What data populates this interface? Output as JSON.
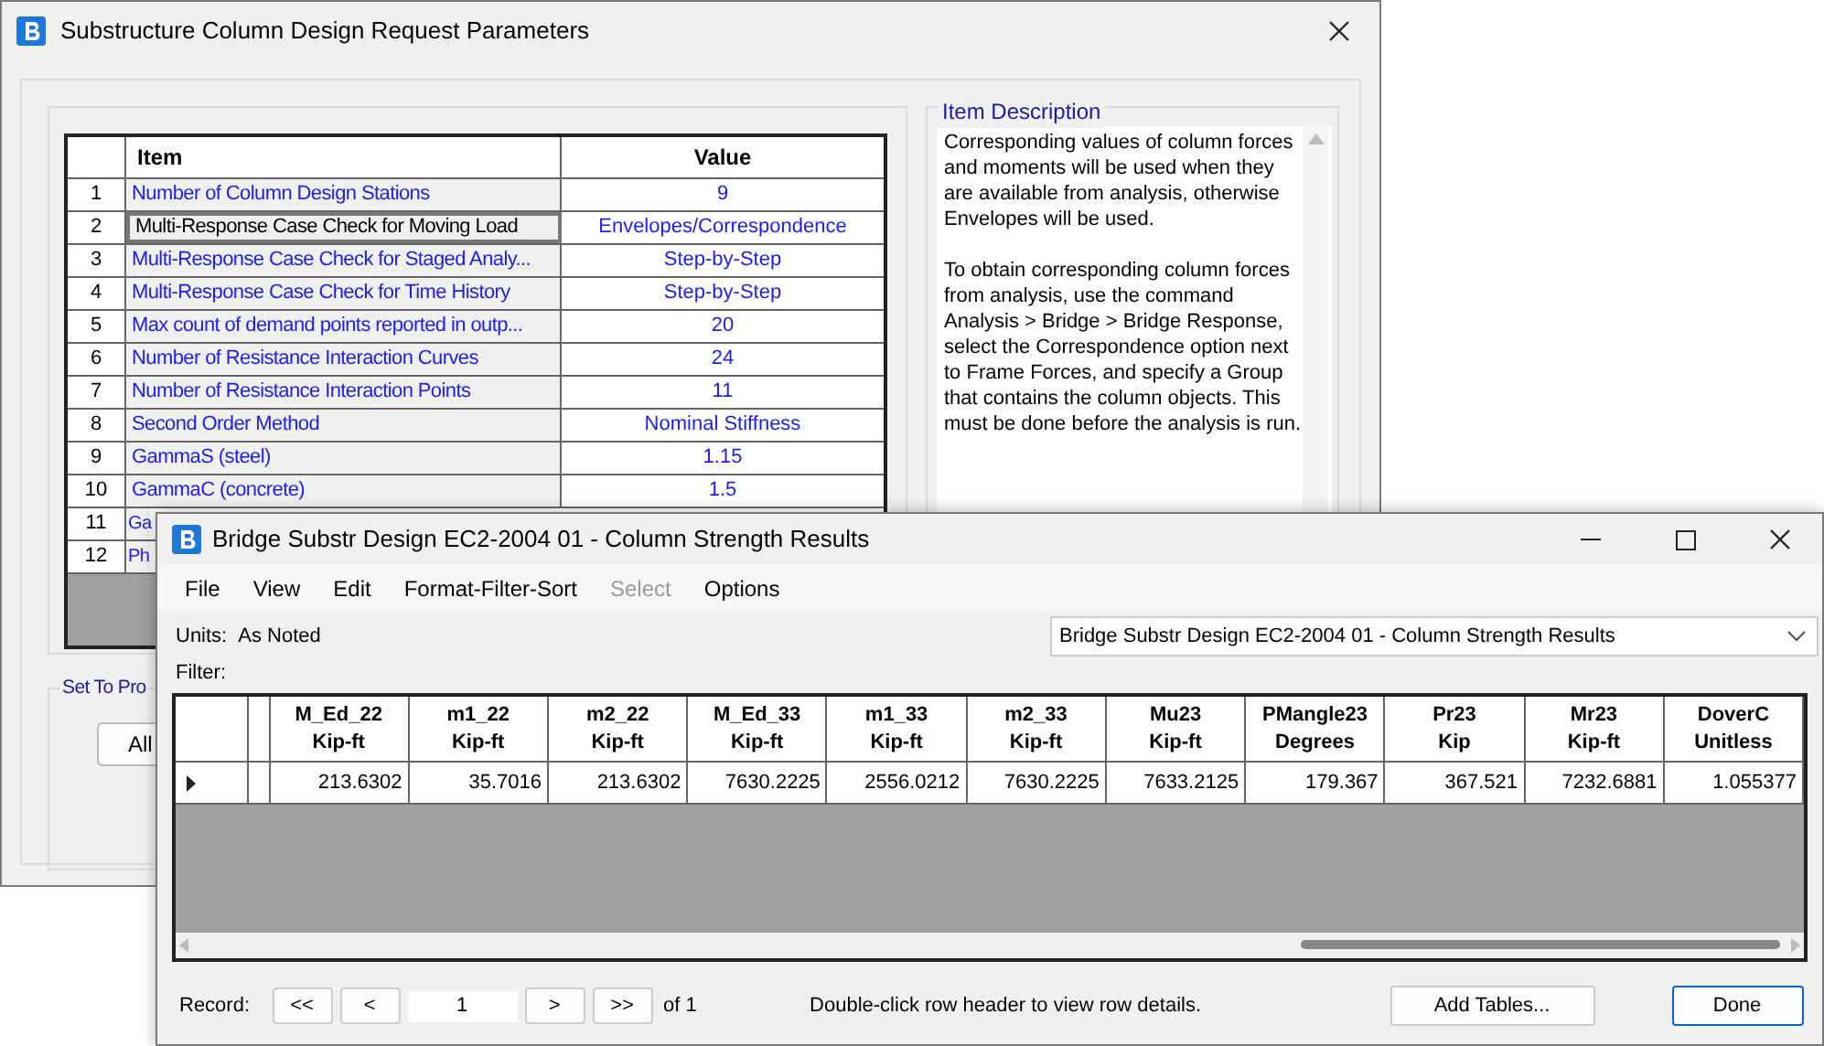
{
  "back_window": {
    "title": "Substructure Column Design Request Parameters",
    "table": {
      "columns": [
        "Item",
        "Value"
      ],
      "rows": [
        {
          "index": "1",
          "item": "Number of Column Design Stations",
          "value": "9",
          "selected": false
        },
        {
          "index": "2",
          "item": "Multi-Response Case Check for Moving Load",
          "value": "Envelopes/Correspondence",
          "selected": true
        },
        {
          "index": "3",
          "item": "Multi-Response Case Check for Staged Analy...",
          "value": "Step-by-Step",
          "selected": false
        },
        {
          "index": "4",
          "item": "Multi-Response Case Check for Time History",
          "value": "Step-by-Step",
          "selected": false
        },
        {
          "index": "5",
          "item": "Max count of demand points reported in outp...",
          "value": "20",
          "selected": false
        },
        {
          "index": "6",
          "item": "Number of Resistance Interaction Curves",
          "value": "24",
          "selected": false
        },
        {
          "index": "7",
          "item": "Number of Resistance Interaction Points",
          "value": "11",
          "selected": false
        },
        {
          "index": "8",
          "item": "Second Order Method",
          "value": "Nominal Stiffness",
          "selected": false
        },
        {
          "index": "9",
          "item": "GammaS (steel)",
          "value": "1.15",
          "selected": false
        },
        {
          "index": "10",
          "item": "GammaC (concrete)",
          "value": "1.5",
          "selected": false
        },
        {
          "index": "11",
          "item": "Ga",
          "selected": false
        },
        {
          "index": "12",
          "item": "Ph",
          "selected": false
        }
      ]
    },
    "description": {
      "label": "Item Description",
      "paragraphs": [
        "Corresponding values of column forces and moments will be used when they are available from analysis, otherwise Envelopes will be used.",
        "To obtain corresponding column forces from analysis, use the command Analysis > Bridge > Bridge Response, select the Correspondence option next to Frame Forces, and specify a Group that contains the column objects. This must be done before the analysis is run."
      ]
    },
    "group": {
      "label": "Set To Pro",
      "buttons": [
        "All"
      ]
    }
  },
  "front_window": {
    "title": "Bridge Substr Design EC2-2004 01 - Column Strength Results",
    "menu": [
      {
        "label": "File",
        "disabled": false
      },
      {
        "label": "View",
        "disabled": false
      },
      {
        "label": "Edit",
        "disabled": false
      },
      {
        "label": "Format-Filter-Sort",
        "disabled": false
      },
      {
        "label": "Select",
        "disabled": true
      },
      {
        "label": "Options",
        "disabled": false
      }
    ],
    "units_label": "Units:",
    "units_value": "As Noted",
    "filter_label": "Filter:",
    "table_select": "Bridge Substr Design EC2-2004 01 - Column Strength Results",
    "grid": {
      "columns": [
        {
          "name": "M_Ed_22",
          "unit": "Kip-ft"
        },
        {
          "name": "m1_22",
          "unit": "Kip-ft"
        },
        {
          "name": "m2_22",
          "unit": "Kip-ft"
        },
        {
          "name": "M_Ed_33",
          "unit": "Kip-ft"
        },
        {
          "name": "m1_33",
          "unit": "Kip-ft"
        },
        {
          "name": "m2_33",
          "unit": "Kip-ft"
        },
        {
          "name": "Mu23",
          "unit": "Kip-ft"
        },
        {
          "name": "PMangle23",
          "unit": "Degrees"
        },
        {
          "name": "Pr23",
          "unit": "Kip"
        },
        {
          "name": "Mr23",
          "unit": "Kip-ft"
        },
        {
          "name": "DoverC",
          "unit": "Unitless"
        }
      ],
      "rows": [
        {
          "current": true,
          "cells": [
            "213.6302",
            "35.7016",
            "213.6302",
            "7630.2225",
            "2556.0212",
            "7630.2225",
            "7633.2125",
            "179.367",
            "367.521",
            "7232.6881",
            "1.055377"
          ]
        }
      ]
    },
    "record": {
      "label": "Record:",
      "prev_buttons": [
        "<<",
        "<"
      ],
      "value": "1",
      "next_buttons": [
        ">",
        ">>"
      ],
      "of": "of 1"
    },
    "hint": "Double-click row header to view row details.",
    "buttons": [
      {
        "label": "Add Tables...",
        "default": false
      },
      {
        "label": "Done",
        "default": true
      }
    ]
  }
}
